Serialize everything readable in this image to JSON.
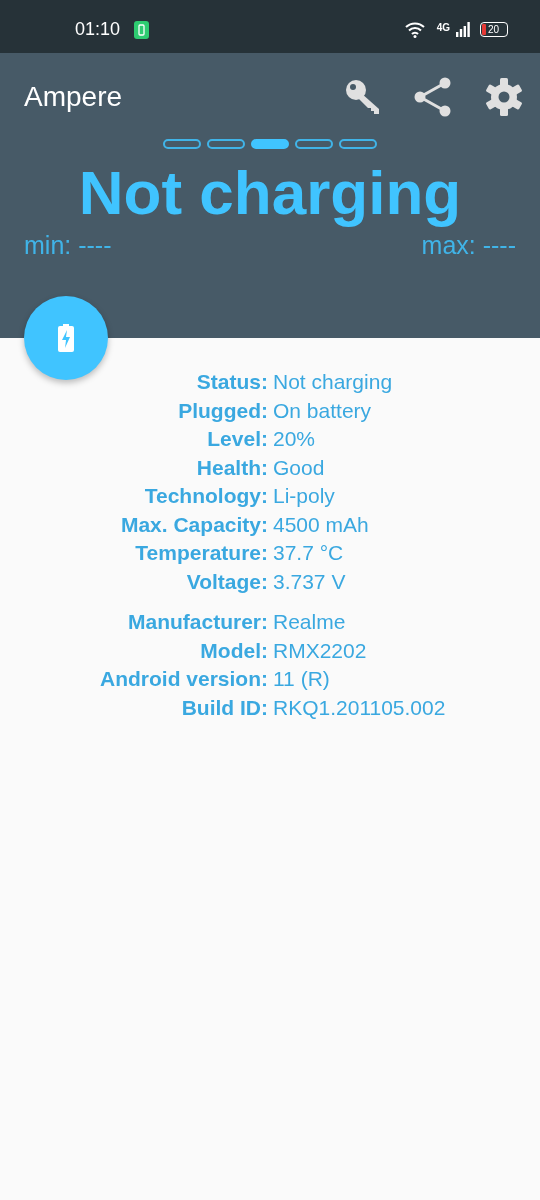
{
  "status_bar": {
    "time": "01:10",
    "network": "4G",
    "battery": "20"
  },
  "app_bar": {
    "title": "Ampere"
  },
  "pages": [
    {
      "selected": false
    },
    {
      "selected": false
    },
    {
      "selected": true
    },
    {
      "selected": false
    },
    {
      "selected": false
    }
  ],
  "headline": "Not charging",
  "min": "min: ----",
  "max": "max: ----",
  "groups": [
    [
      {
        "label": "Status:",
        "value": "Not charging"
      },
      {
        "label": "Plugged:",
        "value": "On battery"
      },
      {
        "label": "Level:",
        "value": "20%"
      },
      {
        "label": "Health:",
        "value": "Good"
      },
      {
        "label": "Technology:",
        "value": "Li-poly"
      },
      {
        "label": "Max. Capacity:",
        "value": "4500 mAh"
      },
      {
        "label": "Temperature:",
        "value": "37.7 °C"
      },
      {
        "label": "Voltage:",
        "value": "3.737 V"
      }
    ],
    [
      {
        "label": "Manufacturer:",
        "value": "Realme"
      },
      {
        "label": "Model:",
        "value": "RMX2202"
      },
      {
        "label": "Android version:",
        "value": "11 (R)"
      },
      {
        "label": "Build ID:",
        "value": "RKQ1.201105.002"
      }
    ]
  ]
}
